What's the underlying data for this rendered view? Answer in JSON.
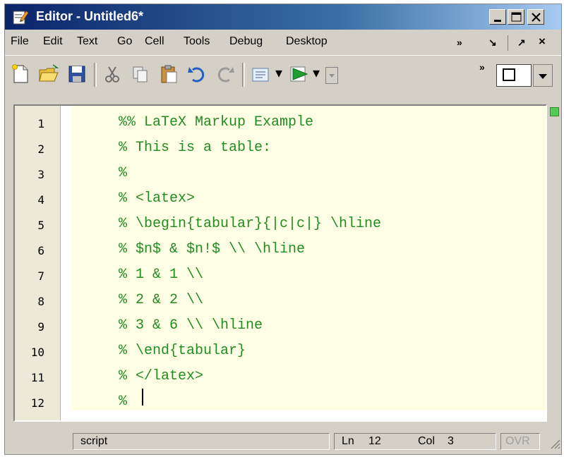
{
  "window": {
    "title": "Editor - Untitled6*",
    "app_icon": "pencil-page-icon",
    "controls": [
      "minimize-icon",
      "maximize-icon",
      "close-icon"
    ]
  },
  "menubar": {
    "items": [
      "File",
      "Edit",
      "Text",
      "Go",
      "Cell",
      "Tools",
      "Debug",
      "Desktop"
    ],
    "overflow_glyph": "»",
    "dock_glyph": "↘",
    "undock_glyph": "↗",
    "close_glyph": "×"
  },
  "toolbar": {
    "buttons": [
      "new-file-icon",
      "open-folder-icon",
      "save-icon",
      "cut-icon",
      "copy-icon",
      "paste-icon",
      "undo-icon",
      "redo-icon",
      "comment-icon",
      "run-icon"
    ],
    "overflow_glyph": "»"
  },
  "editor": {
    "line_numbers": [
      "1",
      "2",
      "3",
      "4",
      "5",
      "6",
      "7",
      "8",
      "9",
      "10",
      "11",
      "12"
    ],
    "lines": [
      "%% LaTeX Markup Example",
      "% This is a table:",
      "%",
      "% <latex>",
      "% \\begin{tabular}{|c|c|} \\hline",
      "% $n$ & $n!$ \\\\ \\hline",
      "% 1 & 1 \\\\",
      "% 2 & 2 \\\\",
      "% 3 & 6 \\\\ \\hline",
      "% \\end{tabular}",
      "% </latex>",
      "% "
    ],
    "comment_color": "#228b22",
    "cell_background": "#ffffe6"
  },
  "statusbar": {
    "mode": "script",
    "ln_label": "Ln",
    "ln_value": "12",
    "col_label": "Col",
    "col_value": "3",
    "ovr": "OVR"
  }
}
